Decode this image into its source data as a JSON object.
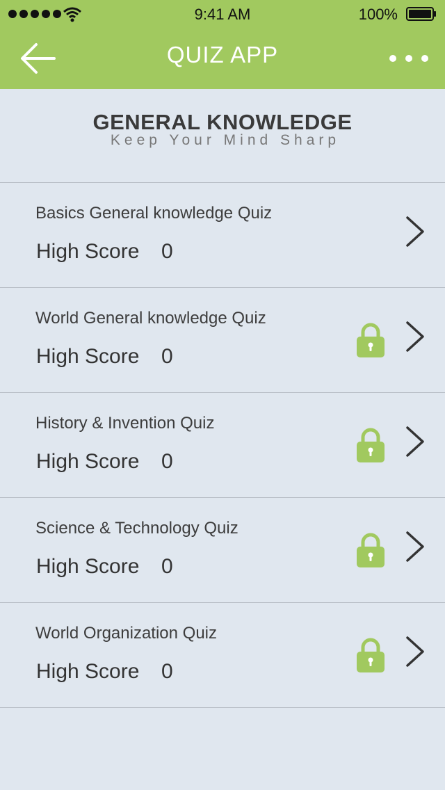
{
  "status_bar": {
    "time": "9:41 AM",
    "battery_percent": "100%",
    "battery_level": 1.0,
    "signal_dots": 5
  },
  "nav": {
    "title": "QUIZ APP",
    "back_icon": "arrow-left-icon",
    "more_icon": "more-horizontal-icon"
  },
  "header": {
    "title": "GENERAL KNOWLEDGE",
    "tagline": "Keep Your Mind Sharp"
  },
  "colors": {
    "accent": "#a1c95f",
    "background": "#e0e7ef",
    "divider": "#b8bec6",
    "lock": "#a1c95f"
  },
  "quizzes": [
    {
      "name": "Basics General knowledge Quiz",
      "score_label": "High Score",
      "score": "0",
      "locked": false
    },
    {
      "name": "World General knowledge Quiz",
      "score_label": "High Score",
      "score": "0",
      "locked": true
    },
    {
      "name": "History & Invention Quiz",
      "score_label": "High Score",
      "score": "0",
      "locked": true
    },
    {
      "name": "Science & Technology Quiz",
      "score_label": "High Score",
      "score": "0",
      "locked": true
    },
    {
      "name": "World Organization Quiz",
      "score_label": "High Score",
      "score": "0",
      "locked": true
    }
  ]
}
